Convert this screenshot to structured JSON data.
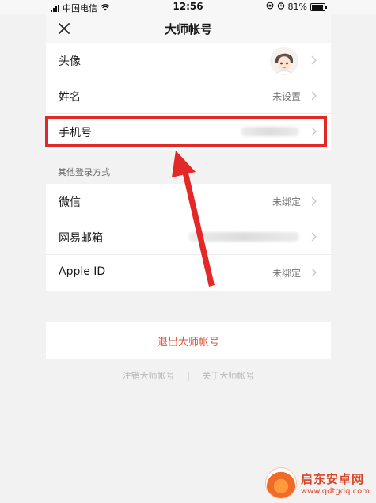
{
  "status_bar": {
    "carrier": "中国电信",
    "time": "12:56",
    "battery_percent": "81%",
    "battery_level": 0.81
  },
  "nav": {
    "title": "大师帐号",
    "close_icon": "close-icon"
  },
  "profile_rows": [
    {
      "label": "头像",
      "value": "",
      "icon": "avatar"
    },
    {
      "label": "姓名",
      "value": "未设置"
    },
    {
      "label": "手机号",
      "value": ""
    }
  ],
  "section": {
    "label": "其他登录方式"
  },
  "login_rows": [
    {
      "label": "微信",
      "value": "未绑定"
    },
    {
      "label": "网易邮箱",
      "value": ""
    },
    {
      "label": "Apple ID",
      "value": "未绑定"
    }
  ],
  "actions": {
    "logout_label": "退出大师帐号",
    "deregister_label": "注销大师帐号",
    "separator": "|",
    "about_label": "关于大师帐号"
  },
  "watermark": {
    "title": "启东安卓网",
    "url": "www.qdtgdq.com"
  },
  "colors": {
    "accent_red": "#e22927",
    "logout_red": "#e0533b",
    "background": "#f2f2f2"
  }
}
